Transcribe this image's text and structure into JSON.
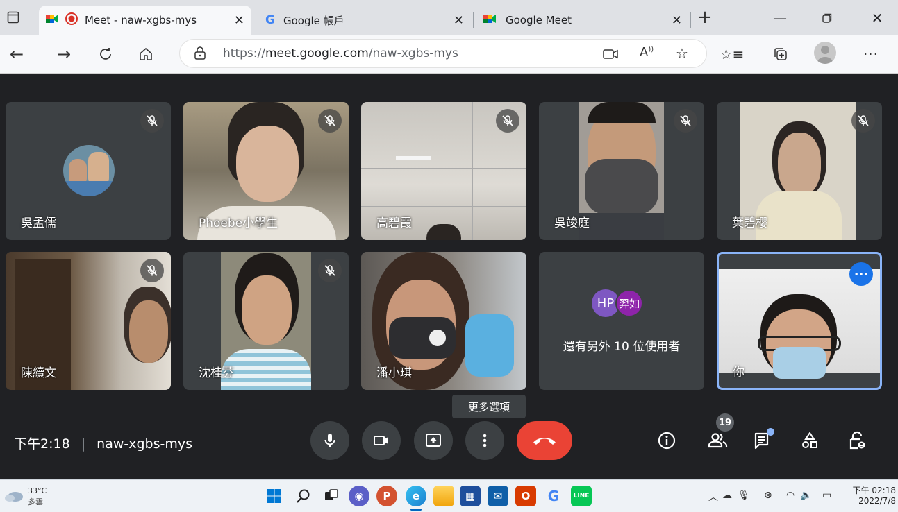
{
  "browser": {
    "tabs": [
      {
        "title": "Meet - naw-xgbs-mys"
      },
      {
        "title": "Google 帳戶"
      },
      {
        "title": "Google Meet"
      }
    ],
    "url_prefix": "https://",
    "url_host": "meet.google.com",
    "url_path": "/naw-xgbs-mys"
  },
  "meeting": {
    "participants": [
      {
        "name": "吳孟儒",
        "muted": true
      },
      {
        "name": "Phoebe小學生",
        "muted": true
      },
      {
        "name": "高碧霞",
        "muted": true
      },
      {
        "name": "吳竣庭",
        "muted": true
      },
      {
        "name": "葉碧櫻",
        "muted": true
      },
      {
        "name": "陳續文",
        "muted": true
      },
      {
        "name": "沈桂芬",
        "muted": true
      },
      {
        "name": "潘小琪",
        "muted": false
      },
      {
        "name": "你",
        "muted": false
      }
    ],
    "others": {
      "avatar1": "HP",
      "avatar2": "羿如",
      "label": "還有另外 10 位使用者",
      "avatar1_color": "#7e57c2",
      "avatar2_color": "#8e24aa"
    },
    "time": "下午2:18",
    "separator": "|",
    "code": "naw-xgbs-mys",
    "tooltip": "更多選項",
    "people_count": "19"
  },
  "taskbar": {
    "temp": "33°C",
    "weather": "多雲",
    "clock_time": "下午 02:18",
    "clock_date": "2022/7/8"
  },
  "colors": {
    "accent": "#1a73e8",
    "end_call": "#ea4335",
    "tile": "#3c4043"
  }
}
